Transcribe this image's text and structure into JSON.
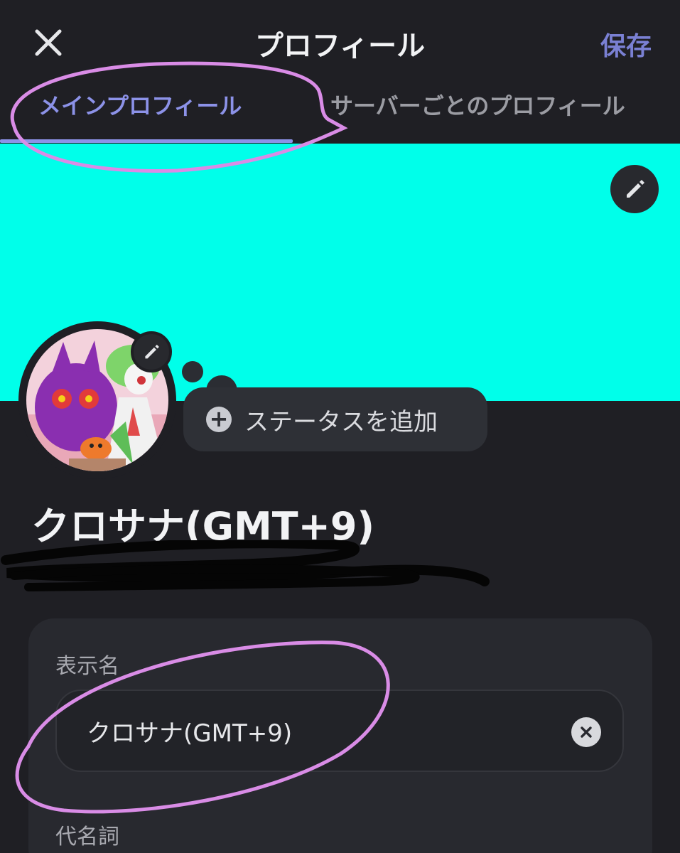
{
  "header": {
    "title": "プロフィール",
    "save_label": "保存",
    "close_icon": "close-icon"
  },
  "tabs": [
    {
      "label": "メインプロフィール",
      "active": true
    },
    {
      "label": "サーバーごとのプロフィール",
      "active": false
    }
  ],
  "banner": {
    "color": "#00ffea",
    "edit_icon": "pencil-icon"
  },
  "avatar": {
    "edit_icon": "pencil-icon"
  },
  "status": {
    "add_label": "ステータスを追加",
    "icon": "plus-circle-icon"
  },
  "profile": {
    "display_name": "クロサナ(GMT+9)"
  },
  "form": {
    "display_name_label": "表示名",
    "display_name_value": "クロサナ(GMT+9)",
    "pronouns_label": "代名詞",
    "clear_icon": "clear-icon"
  },
  "colors": {
    "accent": "#8c92e8",
    "background": "#1f1f24",
    "annotation": "#d98ce6"
  }
}
